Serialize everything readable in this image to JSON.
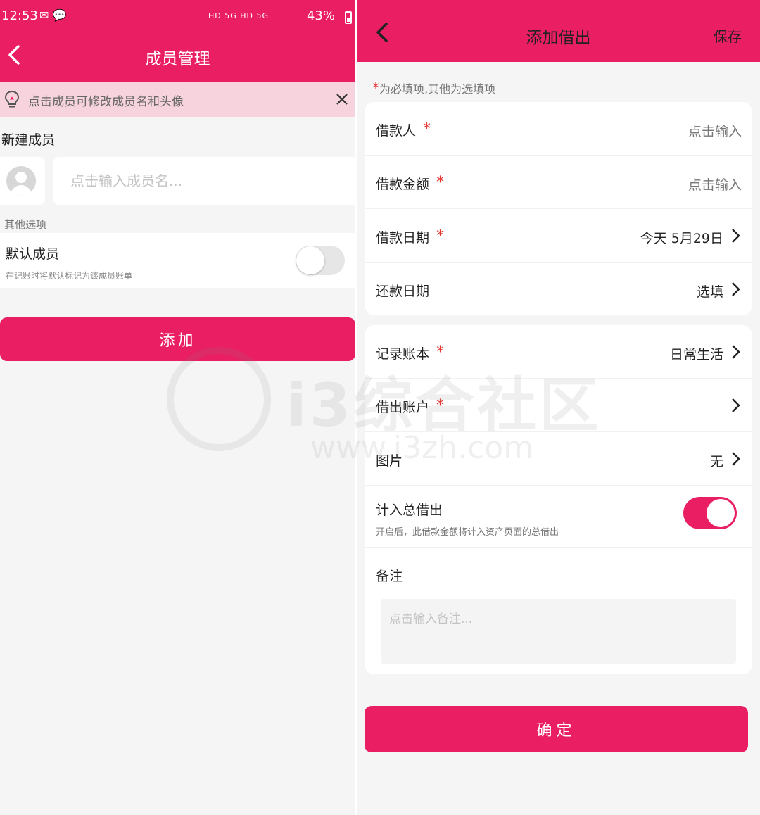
{
  "left": {
    "status": {
      "time": "12:53",
      "app_icons": "✉ 💬",
      "signals": "HD 5G HD 5G",
      "battery": "43%"
    },
    "title": "成员管理",
    "tip": "点击成员可修改成员名和头像",
    "section_new": "新建成员",
    "name_placeholder": "点击输入成员名...",
    "section_other": "其他选项",
    "default_member": {
      "label": "默认成员",
      "sub": "在记账时将默认标记为该成员账单",
      "enabled": false
    },
    "add_button": "添加"
  },
  "right": {
    "title": "添加借出",
    "save": "保存",
    "required_note_star": "*",
    "required_note": "为必填项,其他为选填项",
    "rows1": [
      {
        "label": "借款人",
        "required": true,
        "value": "点击输入"
      },
      {
        "label": "借款金额",
        "required": true,
        "value": "点击输入"
      },
      {
        "label": "借款日期",
        "required": true,
        "value": "今天 5月29日"
      },
      {
        "label": "还款日期",
        "required": false,
        "value": "选填"
      }
    ],
    "rows2": [
      {
        "label": "记录账本",
        "required": true,
        "value": "日常生活"
      },
      {
        "label": "借出账户",
        "required": true,
        "value": ""
      },
      {
        "label": "图片",
        "required": false,
        "value": "无"
      }
    ],
    "include_total": {
      "label": "计入总借出",
      "sub": "开启后，此借款金额将计入资产页面的总借出",
      "enabled": true
    },
    "remark_label": "备注",
    "remark_placeholder": "点击输入备注...",
    "confirm_button": "确定"
  },
  "watermark": {
    "text": "i3综合社区",
    "url": "www.i3zh.com"
  },
  "colors": {
    "primary": "#e91e63",
    "tip_bg": "#f6d3dd",
    "required_star": "#e53935",
    "page_bg": "#f5f5f5"
  }
}
